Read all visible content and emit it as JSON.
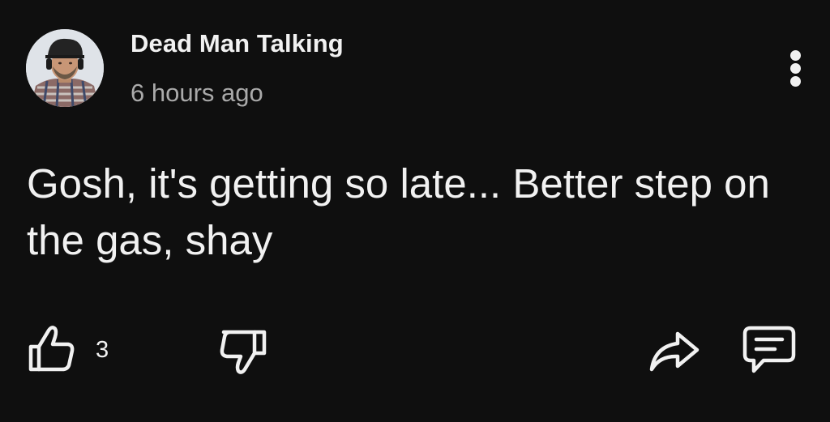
{
  "post": {
    "author": "Dead Man Talking",
    "timestamp": "6 hours ago",
    "message": "Gosh, it's getting so late... Better step on the gas, shay"
  },
  "actions": {
    "like_count": "3"
  },
  "icons": {
    "avatar": "user-avatar",
    "more": "more-vertical-icon",
    "like": "thumbs-up-icon",
    "dislike": "thumbs-down-icon",
    "share": "share-arrow-icon",
    "comment": "comment-icon"
  },
  "colors": {
    "background": "#0f0f0f",
    "text_primary": "#f1f1f1",
    "text_secondary": "#aaaaaa"
  }
}
